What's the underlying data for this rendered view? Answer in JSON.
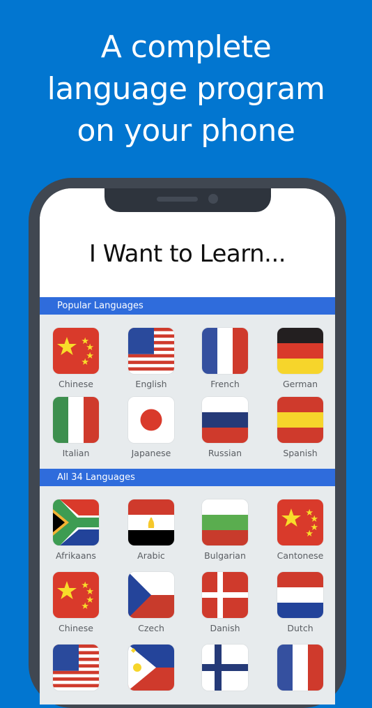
{
  "headline": [
    "A complete",
    "language program",
    "on your phone"
  ],
  "colors": {
    "background": "#0276d0",
    "phone_frame": "#404751",
    "section_header": "#2f6cdc",
    "screen_bg": "#e7ebed"
  },
  "screen": {
    "title": "I Want to Learn...",
    "sections": [
      {
        "header": "Popular Languages",
        "languages": [
          {
            "label": "Chinese",
            "flag": "china-flag-icon"
          },
          {
            "label": "English",
            "flag": "usa-flag-icon"
          },
          {
            "label": "French",
            "flag": "france-flag-icon"
          },
          {
            "label": "German",
            "flag": "germany-flag-icon"
          },
          {
            "label": "Italian",
            "flag": "italy-flag-icon"
          },
          {
            "label": "Japanese",
            "flag": "japan-flag-icon"
          },
          {
            "label": "Russian",
            "flag": "russia-flag-icon"
          },
          {
            "label": "Spanish",
            "flag": "spain-flag-icon"
          }
        ]
      },
      {
        "header": "All 34 Languages",
        "languages": [
          {
            "label": "Afrikaans",
            "flag": "south-africa-flag-icon"
          },
          {
            "label": "Arabic",
            "flag": "egypt-flag-icon"
          },
          {
            "label": "Bulgarian",
            "flag": "bulgaria-flag-icon"
          },
          {
            "label": "Cantonese",
            "flag": "china-flag-icon"
          },
          {
            "label": "Chinese",
            "flag": "china-flag-icon"
          },
          {
            "label": "Czech",
            "flag": "czech-flag-icon"
          },
          {
            "label": "Danish",
            "flag": "denmark-flag-icon"
          },
          {
            "label": "Dutch",
            "flag": "netherlands-flag-icon"
          },
          {
            "label": "",
            "flag": "usa-flag-icon"
          },
          {
            "label": "",
            "flag": "philippines-flag-icon"
          },
          {
            "label": "",
            "flag": "finland-flag-icon"
          },
          {
            "label": "",
            "flag": "france-flag-icon"
          }
        ]
      }
    ]
  }
}
